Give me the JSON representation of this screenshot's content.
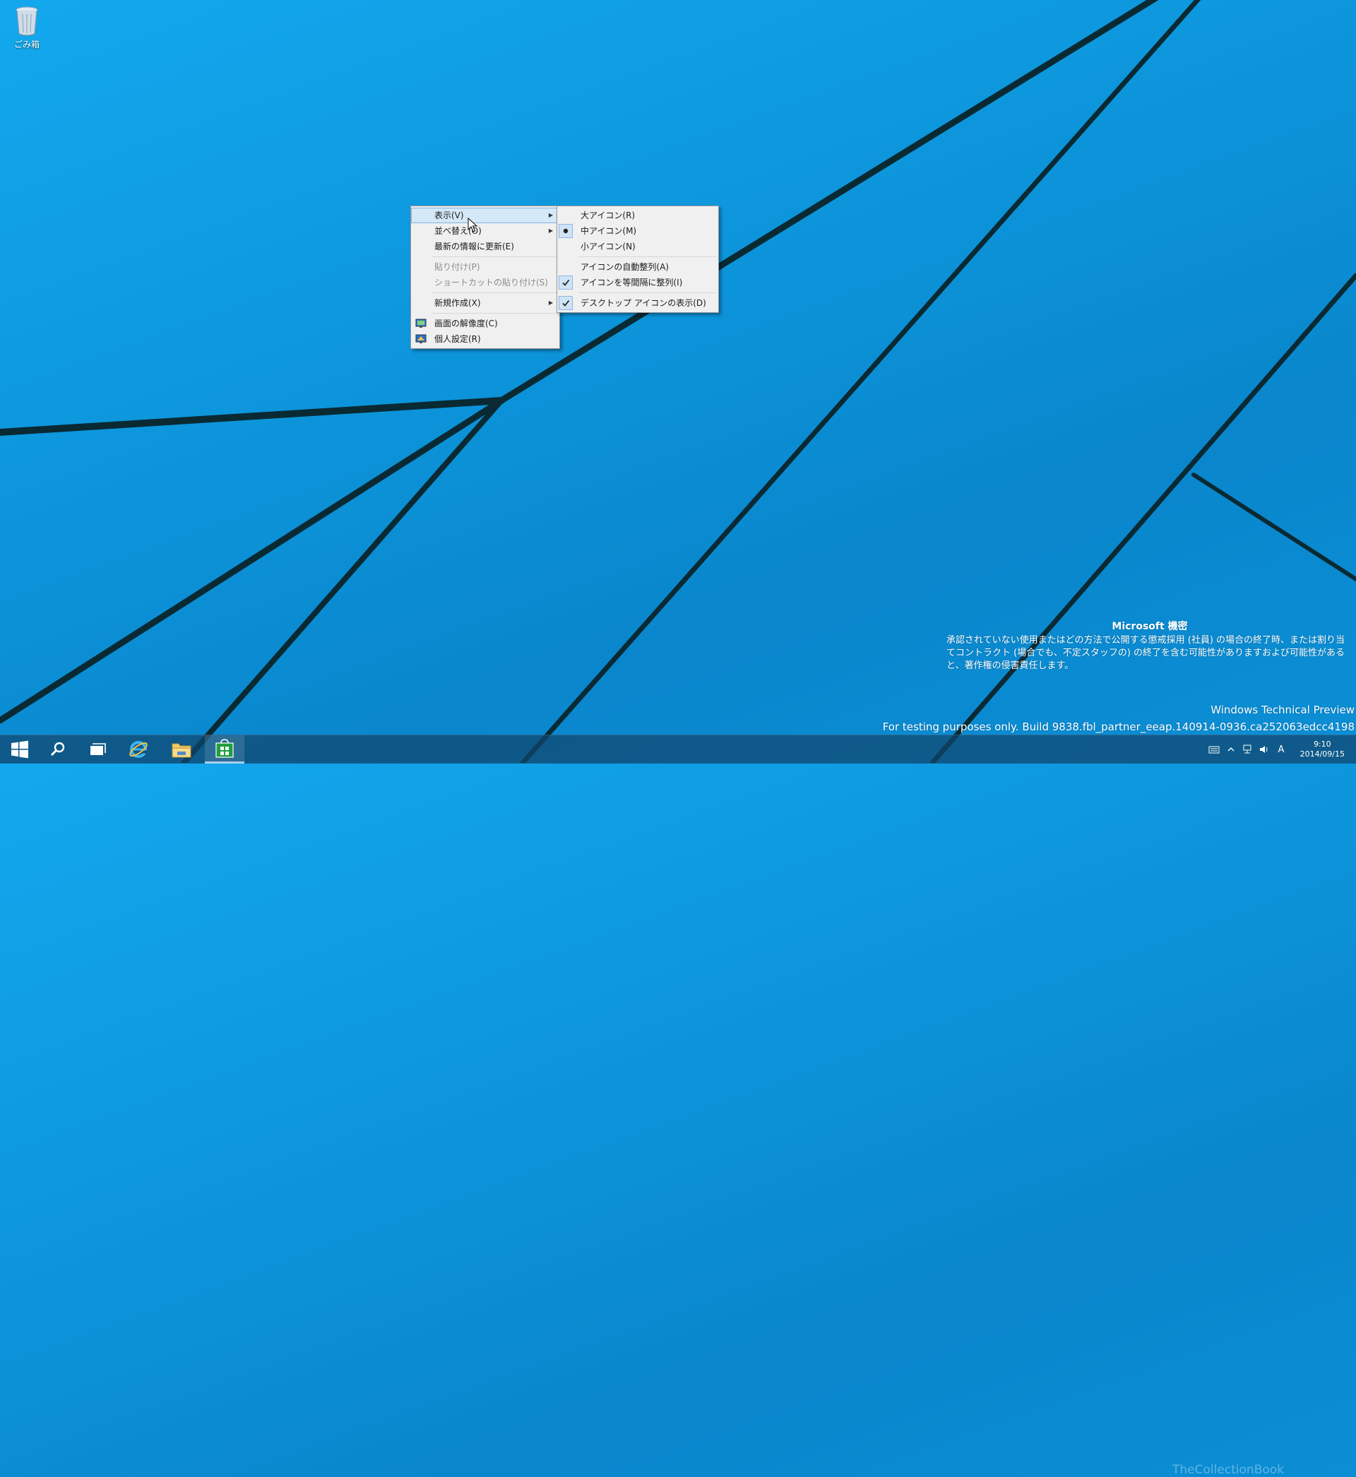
{
  "desktop": {
    "recycle_bin_label": "ごみ箱"
  },
  "context_menu": {
    "items": [
      {
        "label": "表示(V)",
        "submenu": true,
        "highlight": true
      },
      {
        "label": "並べ替え(O)",
        "submenu": true
      },
      {
        "label": "最新の情報に更新(E)"
      },
      {
        "label": "貼り付け(P)",
        "disabled": true
      },
      {
        "label": "ショートカットの貼り付け(S)",
        "disabled": true
      },
      {
        "label": "新規作成(X)",
        "submenu": true
      },
      {
        "label": "画面の解像度(C)",
        "icon": "display-icon"
      },
      {
        "label": "個人設定(R)",
        "icon": "personalize-icon"
      }
    ]
  },
  "view_submenu": {
    "items": [
      {
        "label": "大アイコン(R)"
      },
      {
        "label": "中アイコン(M)",
        "mark": "bullet"
      },
      {
        "label": "小アイコン(N)"
      },
      {
        "label": "アイコンの自動整列(A)"
      },
      {
        "label": "アイコンを等間隔に整列(I)",
        "mark": "check"
      },
      {
        "label": "デスクトップ アイコンの表示(D)",
        "mark": "check"
      }
    ]
  },
  "watermark": {
    "title": "Microsoft 機密",
    "body": "承認されていない使用またはどの方法で公開する懲戒採用 (社員) の場合の終了時、または割り当てコントラクト (場合でも、不定スタッフの) の終了を含む可能性がありますおよび可能性があると、著作権の侵害責任します。",
    "preview": "Windows Technical Preview",
    "build": "For testing purposes only. Build 9838.fbl_partner_eeap.140914-0936.ca252063edcc4198"
  },
  "taskbar": {
    "clock_time": "9:10",
    "clock_date": "2014/09/15",
    "ime": "A",
    "overlay_logo": "TheCollectionBook"
  },
  "colors": {
    "accent": "#0c93d9",
    "menu_highlight": "#d5e8f8"
  }
}
